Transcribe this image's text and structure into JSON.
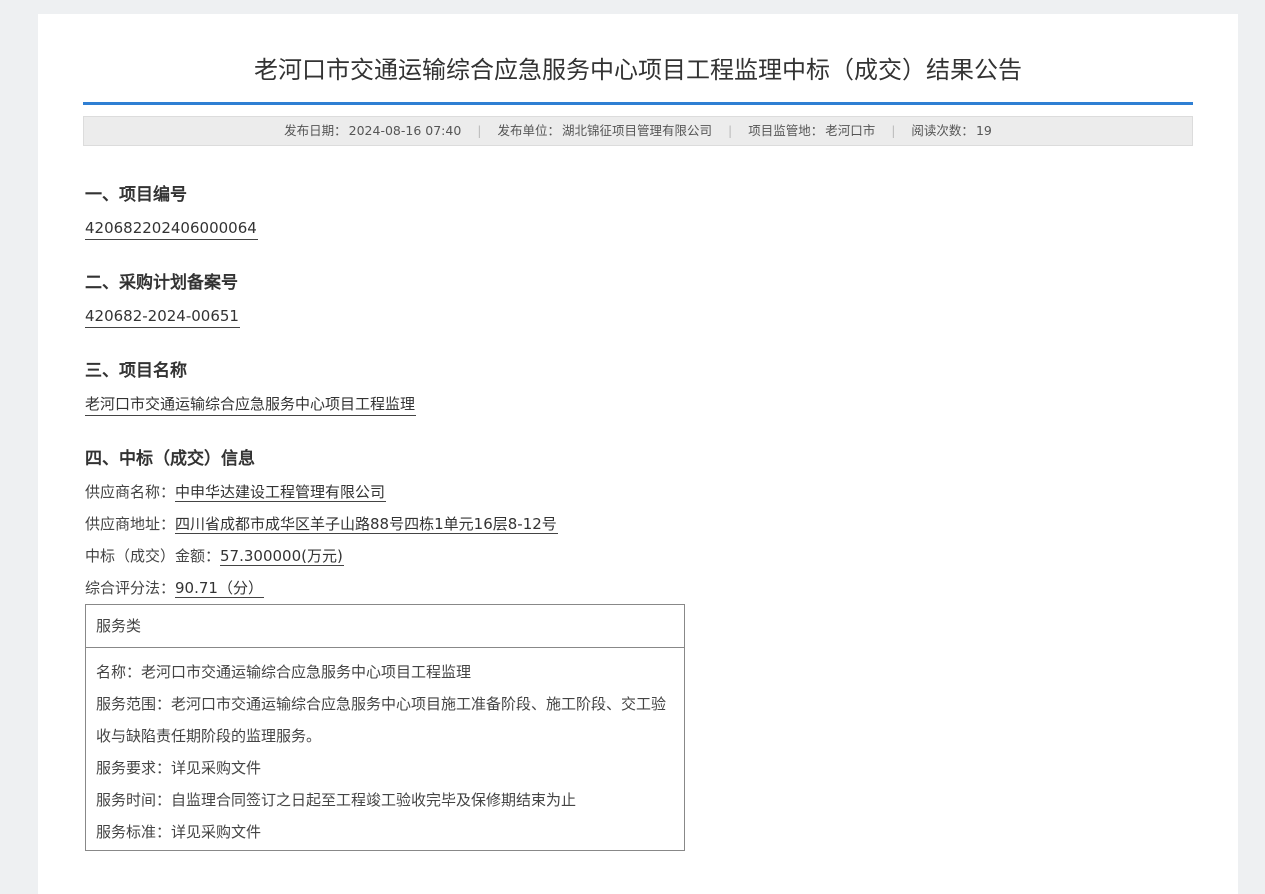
{
  "title": "老河口市交通运输综合应急服务中心项目工程监理中标（成交）结果公告",
  "meta": {
    "date_label": "发布日期：",
    "date": "2024-08-16 07:40",
    "unit_label": "发布单位：",
    "unit": "湖北锦征项目管理有限公司",
    "location_label": "项目监管地：",
    "location": "老河口市",
    "views_label": "阅读次数：",
    "views": "19"
  },
  "sections": {
    "s1_heading": "一、项目编号",
    "s1_value": "420682202406000064",
    "s2_heading": "二、采购计划备案号",
    "s2_value": "420682-2024-00651",
    "s3_heading": "三、项目名称",
    "s3_value": "老河口市交通运输综合应急服务中心项目工程监理",
    "s4_heading": "四、中标（成交）信息"
  },
  "award": {
    "supplier_label": "供应商名称：",
    "supplier": "中申华达建设工程管理有限公司",
    "address_label": "供应商地址：",
    "address": "四川省成都市成华区羊子山路88号四栋1单元16层8-12号",
    "amount_label": "中标（成交）金额：",
    "amount": "57.300000(万元)",
    "score_label": "综合评分法：",
    "score": "90.71（分）"
  },
  "service_table": {
    "category": "服务类",
    "name": "名称：老河口市交通运输综合应急服务中心项目工程监理",
    "scope": "服务范围：老河口市交通运输综合应急服务中心项目施工准备阶段、施工阶段、交工验收与缺陷责任期阶段的监理服务。",
    "requirement": "服务要求：详见采购文件",
    "time": "服务时间：自监理合同签订之日起至工程竣工验收完毕及保修期结束为止",
    "standard": "服务标准：详见采购文件"
  }
}
